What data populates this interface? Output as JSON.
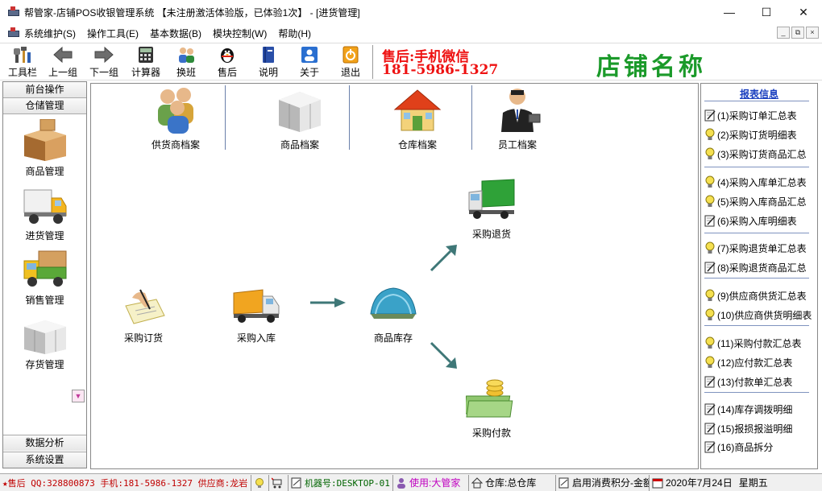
{
  "window": {
    "title": "帮管家-店铺POS收银管理系统 【未注册激活体验版，已体验1次】 - [进货管理]",
    "minimize": "—",
    "maximize": "☐",
    "close": "✕"
  },
  "menu": {
    "items": [
      "系统维护(S)",
      "操作工具(E)",
      "基本数据(B)",
      "模块控制(W)",
      "帮助(H)"
    ],
    "mdi": [
      "_",
      "⧉",
      "×"
    ]
  },
  "toolbar": {
    "items": [
      {
        "label": "工具栏",
        "icon": "tools-icon"
      },
      {
        "label": "上一组",
        "icon": "arrow-left-icon"
      },
      {
        "label": "下一组",
        "icon": "arrow-right-icon"
      },
      {
        "label": "计算器",
        "icon": "calculator-icon"
      },
      {
        "label": "换班",
        "icon": "shift-change-icon"
      },
      {
        "label": "售后",
        "icon": "penguin-icon"
      },
      {
        "label": "说明",
        "icon": "book-icon"
      },
      {
        "label": "关于",
        "icon": "about-icon"
      },
      {
        "label": "退出",
        "icon": "exit-icon"
      }
    ],
    "contact_line1": "售后:手机微信",
    "contact_line2": "181-5986-1327",
    "shop_name": "店铺名称"
  },
  "left_nav": {
    "heads": [
      "前台操作",
      "仓储管理"
    ],
    "items": [
      {
        "label": "商品管理",
        "icon": "boxes-icon"
      },
      {
        "label": "进货管理",
        "icon": "delivery-truck-icon"
      },
      {
        "label": "销售管理",
        "icon": "cargo-truck-icon"
      },
      {
        "label": "存货管理",
        "icon": "gray-boxes-icon"
      }
    ],
    "scroll_down": "▼",
    "foot": [
      "数据分析",
      "系统设置"
    ]
  },
  "main": {
    "top_items": [
      {
        "label": "供货商档案",
        "icon": "suppliers-icon"
      },
      {
        "label": "商品档案",
        "icon": "product-boxes-icon"
      },
      {
        "label": "仓库档案",
        "icon": "warehouse-house-icon"
      },
      {
        "label": "员工档案",
        "icon": "employee-icon"
      }
    ],
    "flow": {
      "order": "采购订货",
      "inbound": "采购入库",
      "stock": "商品库存",
      "return": "采购退货",
      "payment": "采购付款"
    }
  },
  "reports": {
    "title": "报表信息",
    "items": [
      {
        "label": "(1)采购订单汇总表",
        "icon": "note-icon"
      },
      {
        "label": "(2)采购订货明细表",
        "icon": "bulb-icon"
      },
      {
        "label": "(3)采购订货商品汇总",
        "icon": "bulb-icon"
      },
      {
        "label": "(4)采购入库单汇总表",
        "icon": "bulb-icon"
      },
      {
        "label": "(5)采购入库商品汇总",
        "icon": "bulb-icon"
      },
      {
        "label": "(6)采购入库明细表",
        "icon": "note-icon"
      },
      {
        "label": "(7)采购退货单汇总表",
        "icon": "bulb-icon"
      },
      {
        "label": "(8)采购退货商品汇总",
        "icon": "note-icon"
      },
      {
        "label": "(9)供应商供货汇总表",
        "icon": "bulb-icon"
      },
      {
        "label": "(10)供应商供货明细表",
        "icon": "bulb-icon"
      },
      {
        "label": "(11)采购付款汇总表",
        "icon": "bulb-icon"
      },
      {
        "label": "(12)应付款汇总表",
        "icon": "bulb-icon"
      },
      {
        "label": "(13)付款单汇总表",
        "icon": "note-icon"
      },
      {
        "label": "(14)库存调拨明细",
        "icon": "note-icon"
      },
      {
        "label": "(15)报损报溢明细",
        "icon": "note-icon"
      },
      {
        "label": "(16)商品拆分",
        "icon": "note-icon"
      }
    ]
  },
  "status": {
    "marquee": "★售后 QQ:328800873 手机:181-5986-1327 供应商:龙岩",
    "machine": "机器号:DESKTOP-01",
    "user": "使用:大管家",
    "warehouse": "仓库:总仓库",
    "points": "启用消费积分-金额",
    "date": "2020年7月24日",
    "weekday": "星期五",
    "colors": {
      "marquee": "#c00000",
      "user": "#c000c0",
      "machine": "#006400"
    }
  }
}
